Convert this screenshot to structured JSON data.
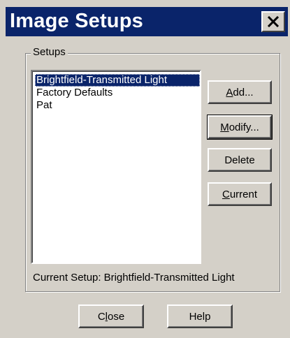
{
  "window": {
    "title": "Image Setups",
    "close_symbol": "✕"
  },
  "group": {
    "legend": "Setups"
  },
  "setups_list": {
    "items": [
      {
        "label": "Brightfield-Transmitted Light",
        "selected": true
      },
      {
        "label": "Factory Defaults",
        "selected": false
      },
      {
        "label": "Pat",
        "selected": false
      }
    ]
  },
  "buttons": {
    "add": {
      "pre": "",
      "mnemonic": "A",
      "post": "dd..."
    },
    "modify": {
      "pre": "",
      "mnemonic": "M",
      "post": "odify..."
    },
    "delete": {
      "label": "Delete"
    },
    "current": {
      "pre": "",
      "mnemonic": "C",
      "post": "urrent"
    },
    "close": {
      "pre": "C",
      "mnemonic": "l",
      "post": "ose"
    },
    "help": {
      "label": "Help"
    }
  },
  "current_setup": {
    "label": "Current Setup:",
    "value": "Brightfield-Transmitted Light"
  },
  "colors": {
    "titlebar": "#0a246a",
    "face": "#d4d0c8",
    "selection": "#0a246a"
  },
  "icons": {
    "close": "close-icon"
  }
}
